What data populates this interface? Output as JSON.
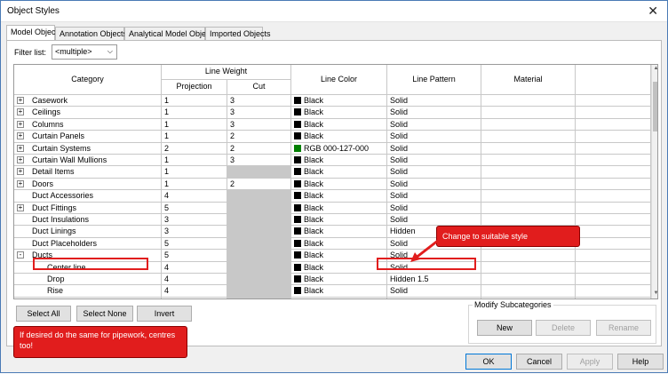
{
  "window": {
    "title": "Object Styles",
    "close_glyph": "✕"
  },
  "tabs": [
    "Model Objects",
    "Annotation Objects",
    "Analytical Model Objects",
    "Imported Objects"
  ],
  "filter": {
    "label": "Filter list:",
    "value": "<multiple>"
  },
  "columns": {
    "category": "Category",
    "line_weight": "Line Weight",
    "projection": "Projection",
    "cut": "Cut",
    "line_color": "Line Color",
    "line_pattern": "Line Pattern",
    "material": "Material"
  },
  "rows": [
    {
      "category": "Casework",
      "expander": "+",
      "projection": "1",
      "cut": "3",
      "color": "Black",
      "color_hex": "#000000",
      "pattern": "Solid",
      "material": ""
    },
    {
      "category": "Ceilings",
      "expander": "+",
      "projection": "1",
      "cut": "3",
      "color": "Black",
      "color_hex": "#000000",
      "pattern": "Solid",
      "material": ""
    },
    {
      "category": "Columns",
      "expander": "+",
      "projection": "1",
      "cut": "3",
      "color": "Black",
      "color_hex": "#000000",
      "pattern": "Solid",
      "material": ""
    },
    {
      "category": "Curtain Panels",
      "expander": "+",
      "projection": "1",
      "cut": "2",
      "color": "Black",
      "color_hex": "#000000",
      "pattern": "Solid",
      "material": ""
    },
    {
      "category": "Curtain Systems",
      "expander": "+",
      "projection": "2",
      "cut": "2",
      "color": "RGB 000-127-000",
      "color_hex": "#007f00",
      "pattern": "Solid",
      "material": ""
    },
    {
      "category": "Curtain Wall Mullions",
      "expander": "+",
      "projection": "1",
      "cut": "3",
      "color": "Black",
      "color_hex": "#000000",
      "pattern": "Solid",
      "material": ""
    },
    {
      "category": "Detail Items",
      "expander": "+",
      "projection": "1",
      "cut": "",
      "cut_gray": true,
      "color": "Black",
      "color_hex": "#000000",
      "pattern": "Solid",
      "material": ""
    },
    {
      "category": "Doors",
      "expander": "+",
      "projection": "1",
      "cut": "2",
      "color": "Black",
      "color_hex": "#000000",
      "pattern": "Solid",
      "material": ""
    },
    {
      "category": "Duct Accessories",
      "expander": "",
      "projection": "4",
      "cut": "",
      "cut_gray": true,
      "color": "Black",
      "color_hex": "#000000",
      "pattern": "Solid",
      "material": ""
    },
    {
      "category": "Duct Fittings",
      "expander": "+",
      "projection": "5",
      "cut": "",
      "cut_gray": true,
      "color": "Black",
      "color_hex": "#000000",
      "pattern": "Solid",
      "material": ""
    },
    {
      "category": "Duct Insulations",
      "expander": "",
      "projection": "3",
      "cut": "",
      "cut_gray": true,
      "color": "Black",
      "color_hex": "#000000",
      "pattern": "Solid",
      "material": ""
    },
    {
      "category": "Duct Linings",
      "expander": "",
      "projection": "3",
      "cut": "",
      "cut_gray": true,
      "color": "Black",
      "color_hex": "#000000",
      "pattern": "Hidden",
      "material": ""
    },
    {
      "category": "Duct Placeholders",
      "expander": "",
      "projection": "5",
      "cut": "",
      "cut_gray": true,
      "color": "Black",
      "color_hex": "#000000",
      "pattern": "Solid",
      "material": ""
    },
    {
      "category": "Ducts",
      "expander": "-",
      "projection": "5",
      "cut": "",
      "cut_gray": true,
      "color": "Black",
      "color_hex": "#000000",
      "pattern": "Solid",
      "material": ""
    },
    {
      "category": "Center line",
      "expander": "",
      "indent": true,
      "projection": "4",
      "cut": "",
      "cut_gray": true,
      "color": "Black",
      "color_hex": "#000000",
      "pattern": "Solid",
      "material": ""
    },
    {
      "category": "Drop",
      "expander": "",
      "indent": true,
      "projection": "4",
      "cut": "",
      "cut_gray": true,
      "color": "Black",
      "color_hex": "#000000",
      "pattern": "Hidden 1.5",
      "material": ""
    },
    {
      "category": "Rise",
      "expander": "",
      "indent": true,
      "projection": "4",
      "cut": "",
      "cut_gray": true,
      "color": "Black",
      "color_hex": "#000000",
      "pattern": "Solid",
      "material": ""
    },
    {
      "category": "",
      "expander": "",
      "projection": "",
      "cut": "",
      "cut_gray": true,
      "color": "",
      "color_hex": "",
      "pattern": "",
      "material": ""
    }
  ],
  "buttons": {
    "select_all": "Select All",
    "select_none": "Select None",
    "invert": "Invert",
    "ok": "OK",
    "cancel": "Cancel",
    "apply": "Apply",
    "help": "Help"
  },
  "subcategories": {
    "title": "Modify Subcategories",
    "new": "New",
    "delete": "Delete",
    "rename": "Rename"
  },
  "callouts": {
    "style_note": "Change to suitable style",
    "pipework_note": "If desired do the same for pipework, centres too!"
  },
  "colors": {
    "callout_red": "#e11d1d",
    "accent_blue": "#0078d7"
  }
}
